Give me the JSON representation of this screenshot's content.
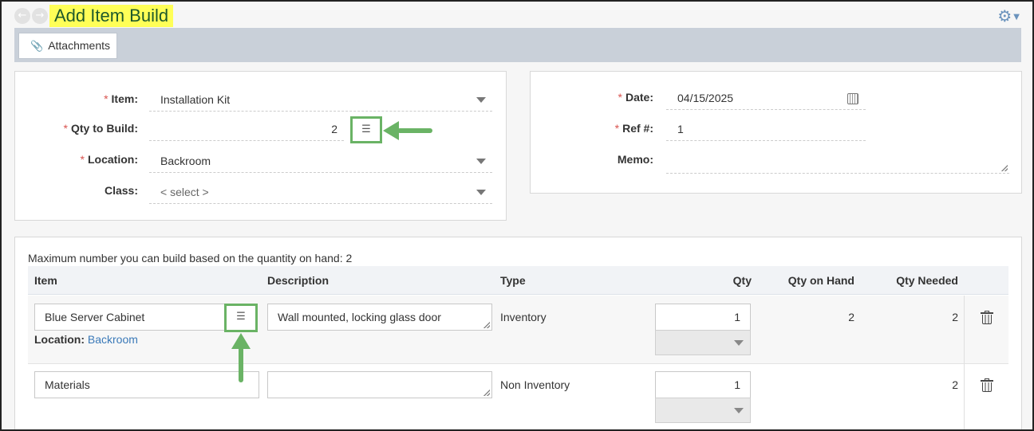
{
  "header": {
    "title": "Add Item Build",
    "back_icon": "arrow-left-circle-icon",
    "forward_icon": "arrow-right-circle-icon",
    "settings_icon": "gear-icon"
  },
  "toolbar": {
    "attachments_label": "Attachments",
    "attachments_icon": "paperclip-icon"
  },
  "form_left": {
    "item": {
      "label": "Item:",
      "value": "Installation Kit"
    },
    "qty_to_build": {
      "label": "Qty to Build:",
      "value": "2"
    },
    "location": {
      "label": "Location:",
      "value": "Backroom"
    },
    "class": {
      "label": "Class:",
      "value": "< select >"
    },
    "required_mark": "*"
  },
  "form_right": {
    "date": {
      "label": "Date:",
      "value": "04/15/2025"
    },
    "ref": {
      "label": "Ref #:",
      "value": "1"
    },
    "memo": {
      "label": "Memo:",
      "value": ""
    }
  },
  "components": {
    "max_note": "Maximum number you can build based on the quantity on hand: 2",
    "columns": [
      "Item",
      "Description",
      "Type",
      "Qty",
      "Qty on Hand",
      "Qty Needed"
    ],
    "rows": [
      {
        "item": "Blue Server Cabinet",
        "location_label": "Location:",
        "location_value": "Backroom",
        "description": "Wall mounted, locking glass door",
        "type": "Inventory",
        "qty": "1",
        "qty_on_hand": "2",
        "qty_needed": "2"
      },
      {
        "item": "Materials",
        "description": "",
        "type": "Non Inventory",
        "qty": "1",
        "qty_on_hand": "",
        "qty_needed": "2"
      }
    ]
  },
  "colors": {
    "title_highlight": "#ffff57",
    "title_text": "#1e5a2b",
    "annotation_green": "#6ab365",
    "toolbar_bg": "#c9d0d9",
    "required_red": "#d9534f",
    "link_blue": "#3a79b8"
  }
}
